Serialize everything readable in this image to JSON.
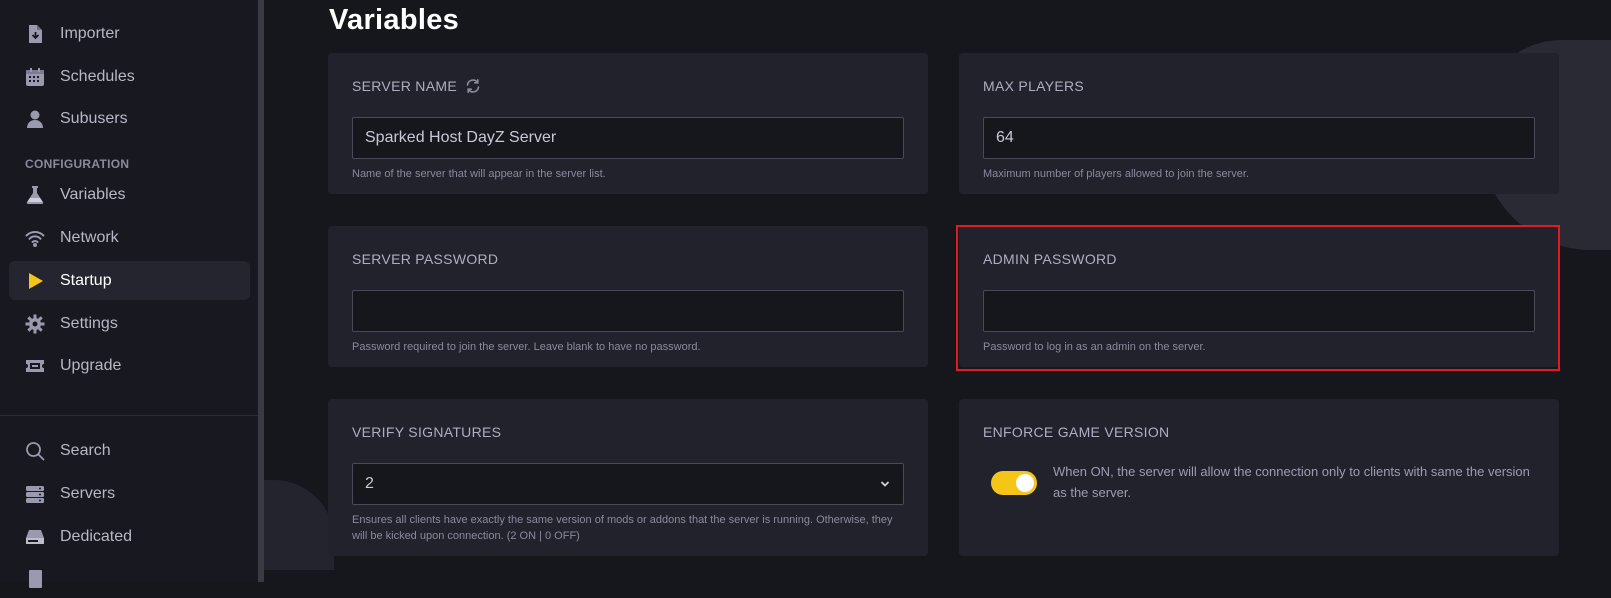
{
  "sidebar": {
    "items_top": [
      {
        "label": "Importer",
        "icon": "file-import-icon"
      },
      {
        "label": "Schedules",
        "icon": "calendar-icon"
      },
      {
        "label": "Subusers",
        "icon": "user-icon"
      }
    ],
    "section_title": "CONFIGURATION",
    "items_config": [
      {
        "label": "Variables",
        "icon": "flask-icon"
      },
      {
        "label": "Network",
        "icon": "wifi-icon"
      },
      {
        "label": "Startup",
        "icon": "play-icon",
        "active": true
      },
      {
        "label": "Settings",
        "icon": "gear-icon"
      },
      {
        "label": "Upgrade",
        "icon": "ticket-icon"
      }
    ],
    "items_bottom": [
      {
        "label": "Search",
        "icon": "search-icon"
      },
      {
        "label": "Servers",
        "icon": "server-icon"
      },
      {
        "label": "Dedicated",
        "icon": "hard-drive-icon"
      }
    ]
  },
  "main": {
    "title": "Variables",
    "cards": {
      "server_name": {
        "label": "SERVER NAME",
        "value": "Sparked Host DayZ Server",
        "helper": "Name of the server that will appear in the server list."
      },
      "max_players": {
        "label": "MAX PLAYERS",
        "value": "64",
        "helper": "Maximum number of players allowed to join the server."
      },
      "server_password": {
        "label": "SERVER PASSWORD",
        "value": "",
        "helper": "Password required to join the server. Leave blank to have no password."
      },
      "admin_password": {
        "label": "ADMIN PASSWORD",
        "value": "",
        "helper": "Password to log in as an admin on the server."
      },
      "verify_signatures": {
        "label": "VERIFY SIGNATURES",
        "value": "2",
        "helper": "Ensures all clients have exactly the same version of mods or addons that the server is running. Otherwise, they will be kicked upon connection. (2 ON | 0 OFF)"
      },
      "enforce_game_version": {
        "label": "ENFORCE GAME VERSION",
        "toggle_on": true,
        "helper": "When ON, the server will allow the connection only to clients with same the version as the server."
      }
    }
  },
  "colors": {
    "accent": "#f5c518",
    "highlight": "#e01b24",
    "card_bg": "#22222c",
    "page_bg": "#16161d"
  }
}
